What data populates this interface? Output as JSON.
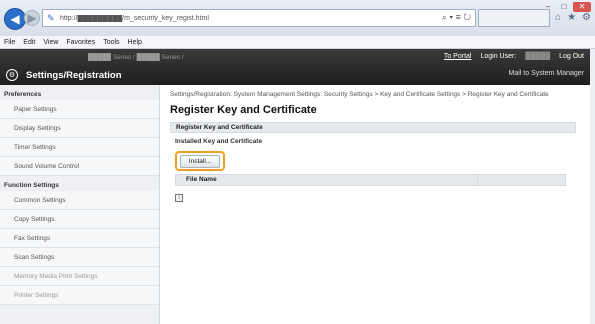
{
  "browser": {
    "url": "http://█████████/m_security_key_regist.html",
    "search_glyph": "⌕ ▾",
    "refresh_glyph": "≡ ↻",
    "menu": [
      "File",
      "Edit",
      "View",
      "Favorites",
      "Tools",
      "Help"
    ],
    "window_controls": [
      "–",
      "□",
      "✕"
    ],
    "toolbar_icons": [
      "⌂",
      "★",
      "⚙"
    ]
  },
  "header": {
    "device_name": "█████ Series / █████ Series /",
    "to_portal": "To Portal",
    "login_user_label": "Login User:",
    "login_user_value": "█████",
    "log_out": "Log Out",
    "app_title": "Settings/Registration",
    "mail_to_manager": "Mail to System Manager"
  },
  "sidebar": {
    "preferences_label": "Preferences",
    "preferences": [
      "Paper Settings",
      "Display Settings",
      "Timer Settings",
      "Sound Volume Control"
    ],
    "function_label": "Function Settings",
    "functions": [
      "Common Settings",
      "Copy Settings",
      "Fax Settings",
      "Scan Settings",
      "Memory Media Print Settings",
      "Printer Settings"
    ]
  },
  "main": {
    "breadcrumb": "Settings/Registration: System Management Settings: Security Settings > Key and Certificate Settings > Register Key and Certificate",
    "title": "Register Key and Certificate",
    "section": "Register Key and Certificate",
    "subsection": "Installed Key and Certificate",
    "install_label": "Install...",
    "column_file_name": "File Name",
    "expand_glyph": "↕"
  }
}
